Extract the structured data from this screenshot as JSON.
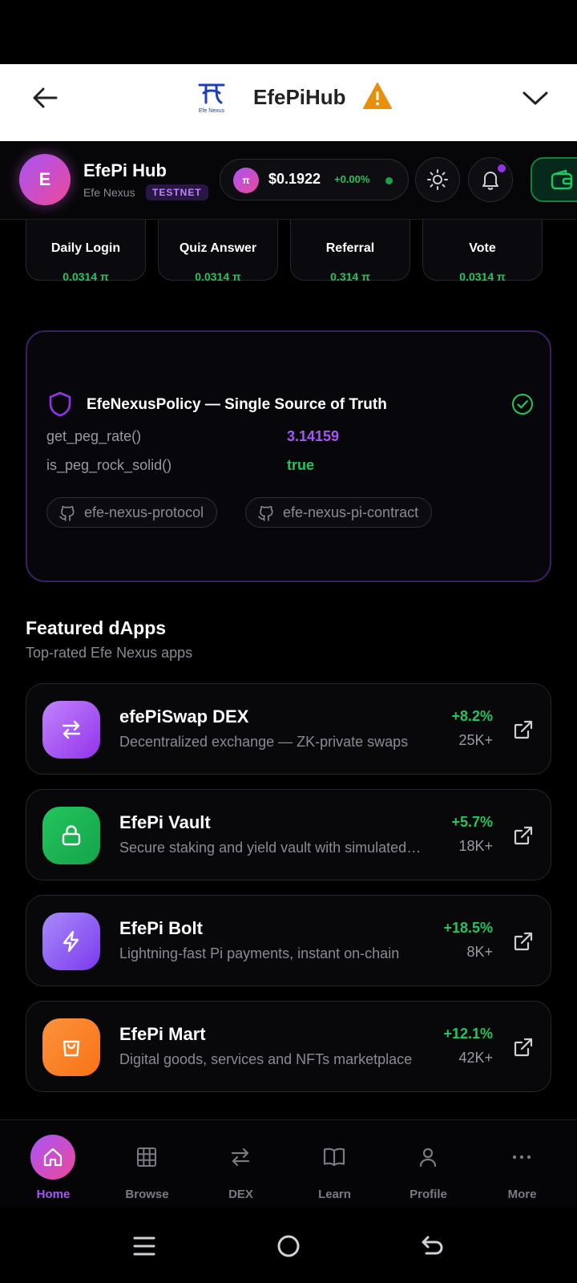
{
  "browser": {
    "title": "EfePiHub",
    "logo_text": "Efe Nexus"
  },
  "header": {
    "avatar_letter": "E",
    "name": "EfePi Hub",
    "subtitle": "Efe Nexus",
    "badge": "TESTNET",
    "pi_symbol": "π",
    "price": "$0.1922",
    "change": "+0.00%"
  },
  "rewards": [
    {
      "label": "Daily Login",
      "value": "0.0314 π",
      "color": "#f97316"
    },
    {
      "label": "Quiz Answer",
      "value": "0.0314 π",
      "color": "#8b5cf6"
    },
    {
      "label": "Referral",
      "value": "0.314 π",
      "color": "#f97316"
    },
    {
      "label": "Vote",
      "value": "0.0314 π",
      "color": "#8b5cf6"
    }
  ],
  "policy": {
    "title": "EfeNexusPolicy — Single Source of Truth",
    "rows": [
      {
        "key": "get_peg_rate()",
        "value": "3.14159",
        "color": "#a855f7"
      },
      {
        "key": "is_peg_rock_solid()",
        "value": "true",
        "color": "#22c55e"
      }
    ],
    "repos": [
      "efe-nexus-protocol",
      "efe-nexus-pi-contract"
    ]
  },
  "featured": {
    "title": "Featured dApps",
    "subtitle": "Top-rated Efe Nexus apps",
    "items": [
      {
        "name": "efePiSwap DEX",
        "desc": "Decentralized exchange — ZK-private swaps",
        "change": "+8.2%",
        "users": "25K+",
        "icon": "swap-icon",
        "gradient": [
          "#c084fc",
          "#9333ea"
        ]
      },
      {
        "name": "EfePi Vault",
        "desc": "Secure staking and yield vault with simulated rewards",
        "change": "+5.7%",
        "users": "18K+",
        "icon": "lock-icon",
        "gradient": [
          "#22c55e",
          "#16a34a"
        ]
      },
      {
        "name": "EfePi Bolt",
        "desc": "Lightning-fast Pi payments, instant on-chain",
        "change": "+18.5%",
        "users": "8K+",
        "icon": "bolt-icon",
        "gradient": [
          "#a78bfa",
          "#7c3aed"
        ]
      },
      {
        "name": "EfePi Mart",
        "desc": "Digital goods, services and NFTs marketplace",
        "change": "+12.1%",
        "users": "42K+",
        "icon": "bag-icon",
        "gradient": [
          "#fb923c",
          "#f97316"
        ]
      }
    ]
  },
  "nav": [
    {
      "label": "Home",
      "icon": "home-icon",
      "active": true
    },
    {
      "label": "Browse",
      "icon": "grid-icon",
      "active": false
    },
    {
      "label": "DEX",
      "icon": "swap-icon",
      "active": false
    },
    {
      "label": "Learn",
      "icon": "book-icon",
      "active": false
    },
    {
      "label": "Profile",
      "icon": "user-icon",
      "active": false
    },
    {
      "label": "More",
      "icon": "more-icon",
      "active": false
    }
  ]
}
